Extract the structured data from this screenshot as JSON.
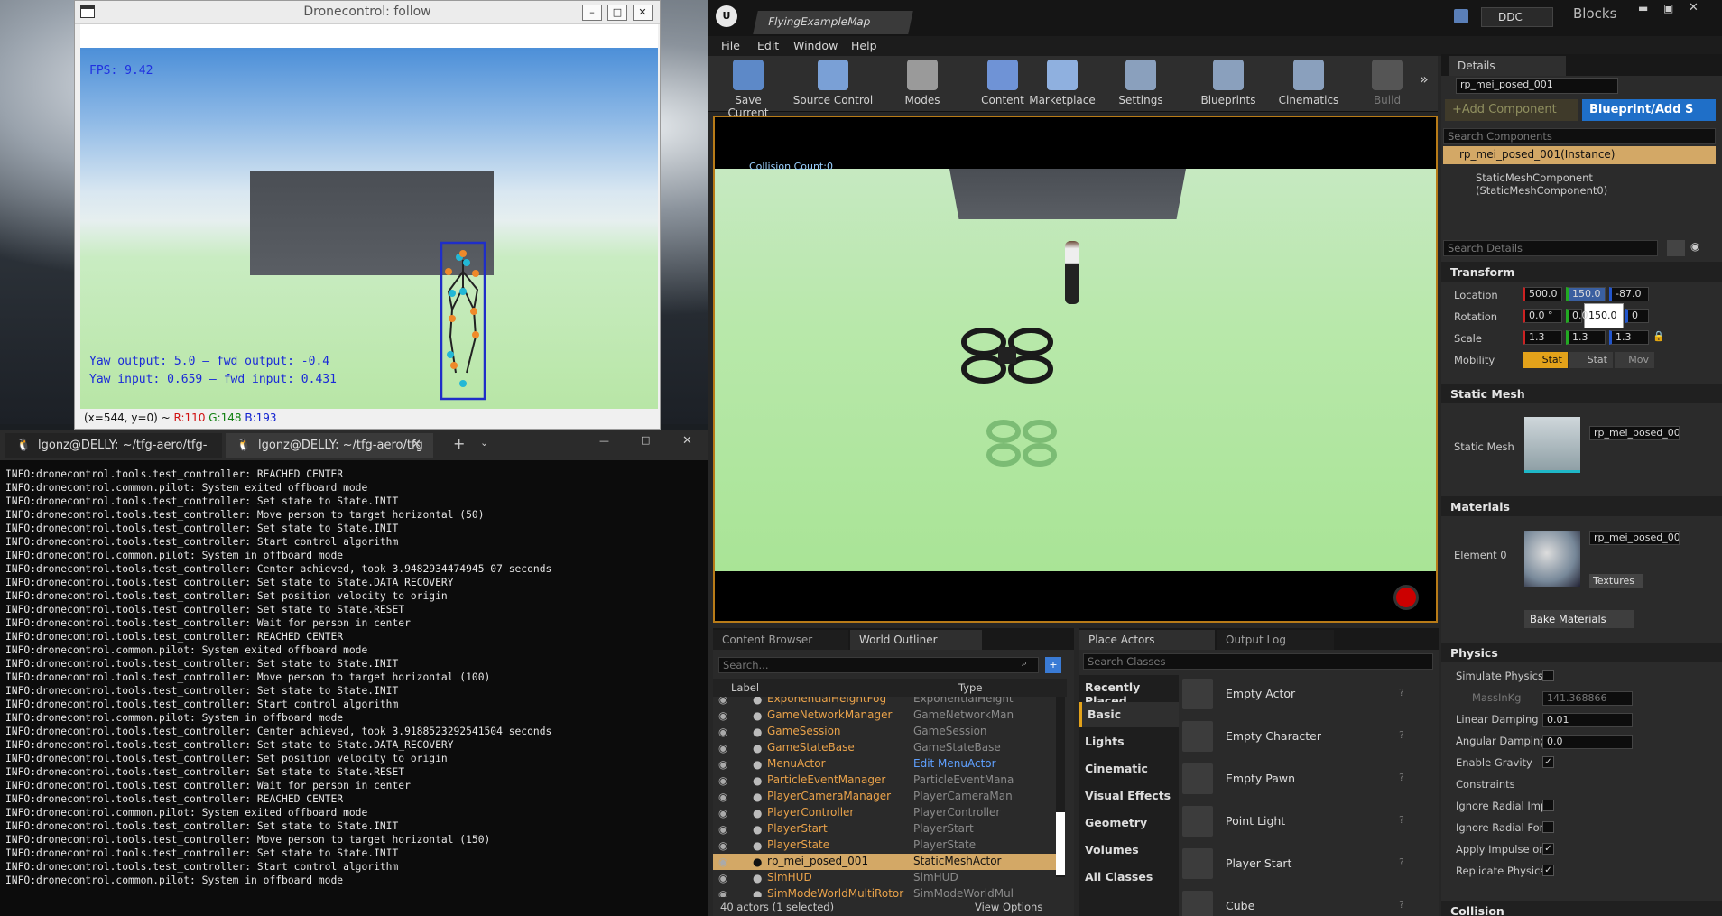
{
  "cv_window": {
    "title": "Dronecontrol: follow",
    "fps": "FPS: 9.42",
    "yaw_output": "Yaw output: 5.0 — fwd output: -0.4",
    "yaw_input": "Yaw input: 0.659 — fwd input: 0.431",
    "status_coords": "(x=544, y=0) ~ ",
    "status_r": "R:110",
    "status_g": "G:148",
    "status_b": "B:193"
  },
  "terminal": {
    "tabs": [
      "lgonz@DELLY: ~/tfg-aero/tfg-",
      "lgonz@DELLY: ~/tfg-aero/tfg"
    ],
    "lines": [
      "INFO:dronecontrol.tools.test_controller: REACHED CENTER",
      "INFO:dronecontrol.common.pilot: System exited offboard mode",
      "INFO:dronecontrol.tools.test_controller: Set state to State.INIT",
      "INFO:dronecontrol.tools.test_controller: Move person to target horizontal (50)",
      "INFO:dronecontrol.tools.test_controller: Set state to State.INIT",
      "INFO:dronecontrol.tools.test_controller: Start control algorithm",
      "INFO:dronecontrol.common.pilot: System in offboard mode",
      "INFO:dronecontrol.tools.test_controller: Center achieved, took 3.9482934474945 07 seconds",
      "INFO:dronecontrol.tools.test_controller: Set state to State.DATA_RECOVERY",
      "INFO:dronecontrol.tools.test_controller: Set position velocity to origin",
      "INFO:dronecontrol.tools.test_controller: Set state to State.RESET",
      "INFO:dronecontrol.tools.test_controller: Wait for person in center",
      "INFO:dronecontrol.tools.test_controller: REACHED CENTER",
      "INFO:dronecontrol.common.pilot: System exited offboard mode",
      "INFO:dronecontrol.tools.test_controller: Set state to State.INIT",
      "INFO:dronecontrol.tools.test_controller: Move person to target horizontal (100)",
      "INFO:dronecontrol.tools.test_controller: Set state to State.INIT",
      "INFO:dronecontrol.tools.test_controller: Start control algorithm",
      "INFO:dronecontrol.common.pilot: System in offboard mode",
      "INFO:dronecontrol.tools.test_controller: Center achieved, took 3.9188523292541504 seconds",
      "INFO:dronecontrol.tools.test_controller: Set state to State.DATA_RECOVERY",
      "INFO:dronecontrol.tools.test_controller: Set position velocity to origin",
      "INFO:dronecontrol.tools.test_controller: Set state to State.RESET",
      "INFO:dronecontrol.tools.test_controller: Wait for person in center",
      "INFO:dronecontrol.tools.test_controller: REACHED CENTER",
      "INFO:dronecontrol.common.pilot: System exited offboard mode",
      "INFO:dronecontrol.tools.test_controller: Set state to State.INIT",
      "INFO:dronecontrol.tools.test_controller: Move person to target horizontal (150)",
      "INFO:dronecontrol.tools.test_controller: Set state to State.INIT",
      "INFO:dronecontrol.tools.test_controller: Start control algorithm",
      "INFO:dronecontrol.common.pilot: System in offboard mode"
    ]
  },
  "ue": {
    "map_tab": "FlyingExampleMap",
    "ddc": "DDC",
    "project": "Blocks",
    "menu": [
      "File",
      "Edit",
      "Window",
      "Help"
    ],
    "toolbar": [
      "Save Current",
      "Source Control",
      "Modes",
      "Content",
      "Marketplace",
      "Settings",
      "Blueprints",
      "Cinematics",
      "Build"
    ],
    "collision": "Collision Count:0",
    "bottom_tabs": [
      "Content Browser",
      "World Outliner",
      "Place Actors",
      "Output Log"
    ],
    "outliner": {
      "search": "Search...",
      "col_label": "Label",
      "col_type": "Type",
      "rows": [
        {
          "label": "ExponentialHeightFog",
          "type": "ExponentialHeight"
        },
        {
          "label": "GameNetworkManager",
          "type": "GameNetworkMan"
        },
        {
          "label": "GameSession",
          "type": "GameSession"
        },
        {
          "label": "GameStateBase",
          "type": "GameStateBase"
        },
        {
          "label": "MenuActor",
          "type": "Edit MenuActor"
        },
        {
          "label": "ParticleEventManager",
          "type": "ParticleEventMana"
        },
        {
          "label": "PlayerCameraManager",
          "type": "PlayerCameraMan"
        },
        {
          "label": "PlayerController",
          "type": "PlayerController"
        },
        {
          "label": "PlayerStart",
          "type": "PlayerStart"
        },
        {
          "label": "PlayerState",
          "type": "PlayerState"
        },
        {
          "label": "rp_mei_posed_001",
          "type": "StaticMeshActor"
        },
        {
          "label": "SimHUD",
          "type": "SimHUD"
        },
        {
          "label": "SimModeWorldMultiRotor",
          "type": "SimModeWorldMul"
        }
      ],
      "footer": "40 actors (1 selected)",
      "view_options": "View Options"
    },
    "place": {
      "search": "Search Classes",
      "cats": [
        "Recently Placed",
        "Basic",
        "Lights",
        "Cinematic",
        "Visual Effects",
        "Geometry",
        "Volumes",
        "All Classes"
      ],
      "items": [
        "Empty Actor",
        "Empty Character",
        "Empty Pawn",
        "Point Light",
        "Player Start",
        "Cube"
      ]
    },
    "details": {
      "tab": "Details",
      "name": "rp_mei_posed_001",
      "add_component": "+Add Component",
      "blueprint": "Blueprint/Add S",
      "search_components": "Search Components",
      "instance": "rp_mei_posed_001(Instance)",
      "component": "StaticMeshComponent (StaticMeshComponent0)",
      "search_details": "Search Details",
      "transform": "Transform",
      "location": "Location",
      "rotation": "Rotation",
      "scale": "Scale",
      "mobility": "Mobility",
      "loc": [
        "500.0",
        "150.0",
        "-87.0"
      ],
      "rot": [
        "0.0 °",
        "0.0",
        "0"
      ],
      "scl": [
        "1.3",
        "1.3",
        "1.3"
      ],
      "tooltip": "150.0",
      "mob": [
        "Stat",
        "Stat",
        "Mov"
      ],
      "static_mesh": "Static Mesh",
      "mesh_asset": "rp_mei_posed_001",
      "materials": "Materials",
      "element0": "Element 0",
      "mat_asset": "rp_mei_posed_001",
      "textures": "Textures",
      "bake": "Bake Materials",
      "physics": "Physics",
      "props": [
        "Simulate Physics",
        "MassInKg",
        "Linear Damping",
        "Angular Damping",
        "Enable Gravity",
        "Constraints",
        "Ignore Radial Imp",
        "Ignore Radial Forc",
        "Apply Impulse on",
        "Replicate Physics"
      ],
      "mass": "141.368866",
      "lin": "0.01",
      "ang": "0.0",
      "collision": "Collision"
    }
  }
}
